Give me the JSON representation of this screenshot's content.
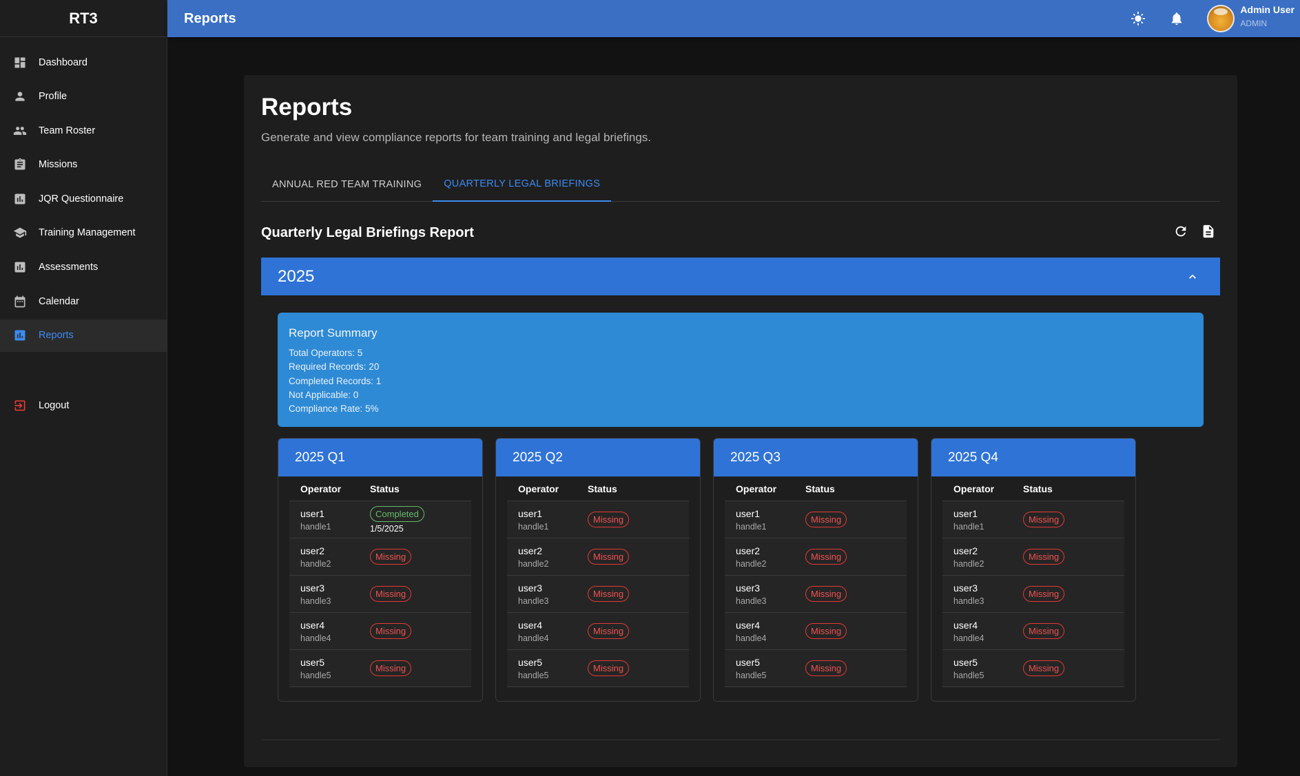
{
  "app": {
    "brand": "RT3"
  },
  "sidebar": {
    "items": [
      {
        "label": "Dashboard",
        "icon": "dashboard-icon"
      },
      {
        "label": "Profile",
        "icon": "person-icon"
      },
      {
        "label": "Team Roster",
        "icon": "group-icon"
      },
      {
        "label": "Missions",
        "icon": "assignment-icon"
      },
      {
        "label": "JQR Questionnaire",
        "icon": "bar-chart-icon"
      },
      {
        "label": "Training Management",
        "icon": "school-icon"
      },
      {
        "label": "Assessments",
        "icon": "bar-chart-icon"
      },
      {
        "label": "Calendar",
        "icon": "calendar-icon"
      },
      {
        "label": "Reports",
        "icon": "bar-chart-icon",
        "active": true
      }
    ],
    "logout": "Logout"
  },
  "topbar": {
    "title": "Reports",
    "user_name": "Admin User",
    "user_role": "ADMIN"
  },
  "page": {
    "title": "Reports",
    "subtitle": "Generate and view compliance reports for team training and legal briefings.",
    "tabs": [
      {
        "label": "ANNUAL RED TEAM TRAINING",
        "active": false
      },
      {
        "label": "QUARTERLY LEGAL BRIEFINGS",
        "active": true
      }
    ],
    "section_title": "Quarterly Legal Briefings Report",
    "year": "2025",
    "summary": {
      "title": "Report Summary",
      "lines": [
        "Total Operators: 5",
        "Required Records: 20",
        "Completed Records: 1",
        "Not Applicable: 0",
        "Compliance Rate: 5%"
      ]
    },
    "table_headers": {
      "operator": "Operator",
      "status": "Status"
    },
    "quarters": [
      {
        "title": "2025 Q1",
        "rows": [
          {
            "user": "user1",
            "handle": "handle1",
            "status": "Completed",
            "date": "1/5/2025"
          },
          {
            "user": "user2",
            "handle": "handle2",
            "status": "Missing"
          },
          {
            "user": "user3",
            "handle": "handle3",
            "status": "Missing"
          },
          {
            "user": "user4",
            "handle": "handle4",
            "status": "Missing"
          },
          {
            "user": "user5",
            "handle": "handle5",
            "status": "Missing"
          }
        ]
      },
      {
        "title": "2025 Q2",
        "rows": [
          {
            "user": "user1",
            "handle": "handle1",
            "status": "Missing"
          },
          {
            "user": "user2",
            "handle": "handle2",
            "status": "Missing"
          },
          {
            "user": "user3",
            "handle": "handle3",
            "status": "Missing"
          },
          {
            "user": "user4",
            "handle": "handle4",
            "status": "Missing"
          },
          {
            "user": "user5",
            "handle": "handle5",
            "status": "Missing"
          }
        ]
      },
      {
        "title": "2025 Q3",
        "rows": [
          {
            "user": "user1",
            "handle": "handle1",
            "status": "Missing"
          },
          {
            "user": "user2",
            "handle": "handle2",
            "status": "Missing"
          },
          {
            "user": "user3",
            "handle": "handle3",
            "status": "Missing"
          },
          {
            "user": "user4",
            "handle": "handle4",
            "status": "Missing"
          },
          {
            "user": "user5",
            "handle": "handle5",
            "status": "Missing"
          }
        ]
      },
      {
        "title": "2025 Q4",
        "rows": [
          {
            "user": "user1",
            "handle": "handle1",
            "status": "Missing"
          },
          {
            "user": "user2",
            "handle": "handle2",
            "status": "Missing"
          },
          {
            "user": "user3",
            "handle": "handle3",
            "status": "Missing"
          },
          {
            "user": "user4",
            "handle": "handle4",
            "status": "Missing"
          },
          {
            "user": "user5",
            "handle": "handle5",
            "status": "Missing"
          }
        ]
      }
    ]
  },
  "colors": {
    "accent": "#3d8bf2",
    "header_blue": "#2f73d6",
    "summary_blue": "#2e8ad4",
    "topbar_blue": "#3a6fc4",
    "missing": "#e53935",
    "completed": "#66bb6a"
  }
}
